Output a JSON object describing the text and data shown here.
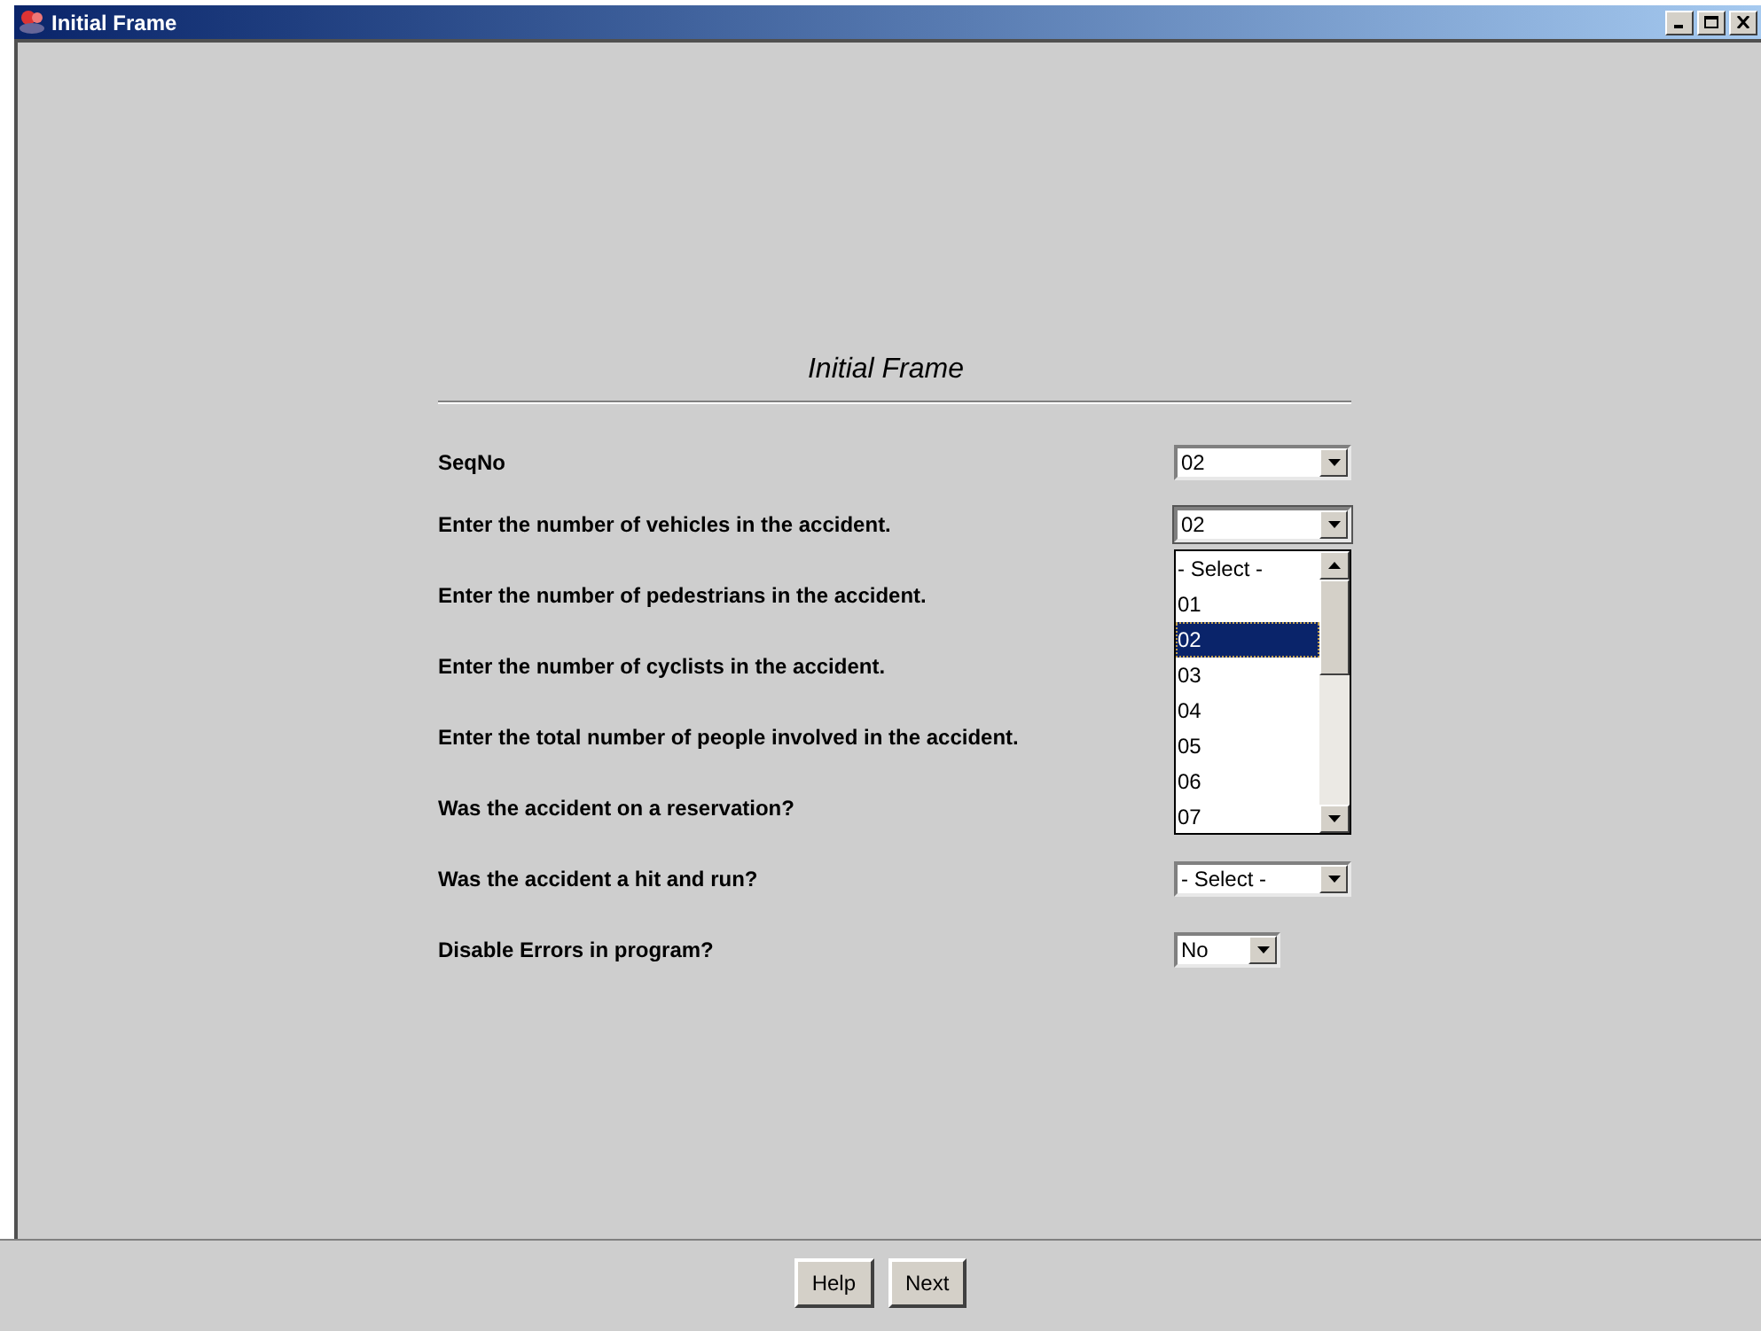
{
  "window": {
    "title": "Initial Frame"
  },
  "form": {
    "heading": "Initial Frame",
    "rows": [
      {
        "label": "SeqNo",
        "combo": {
          "value": "02"
        }
      },
      {
        "label": "Enter the number of vehicles in the accident.",
        "combo": {
          "value": "02",
          "expanded": true
        }
      },
      {
        "label": "Enter the number of pedestrians in the accident."
      },
      {
        "label": "Enter the number of cyclists in the accident."
      },
      {
        "label": "Enter the total number of people involved in the accident."
      },
      {
        "label": "Was the accident on a reservation?"
      },
      {
        "label": "Was the accident a hit and run?",
        "combo": {
          "value": "- Select -"
        }
      },
      {
        "label": "Disable Errors in program?",
        "combo": {
          "value": "No",
          "kind": "narrow"
        }
      }
    ]
  },
  "dropdown": {
    "options": [
      {
        "label": "- Select -",
        "selected": false
      },
      {
        "label": "01",
        "selected": false
      },
      {
        "label": "02",
        "selected": true
      },
      {
        "label": "03",
        "selected": false
      },
      {
        "label": "04",
        "selected": false
      },
      {
        "label": "05",
        "selected": false
      },
      {
        "label": "06",
        "selected": false
      },
      {
        "label": "07",
        "selected": false
      }
    ]
  },
  "buttons": [
    "Help",
    "Next"
  ]
}
